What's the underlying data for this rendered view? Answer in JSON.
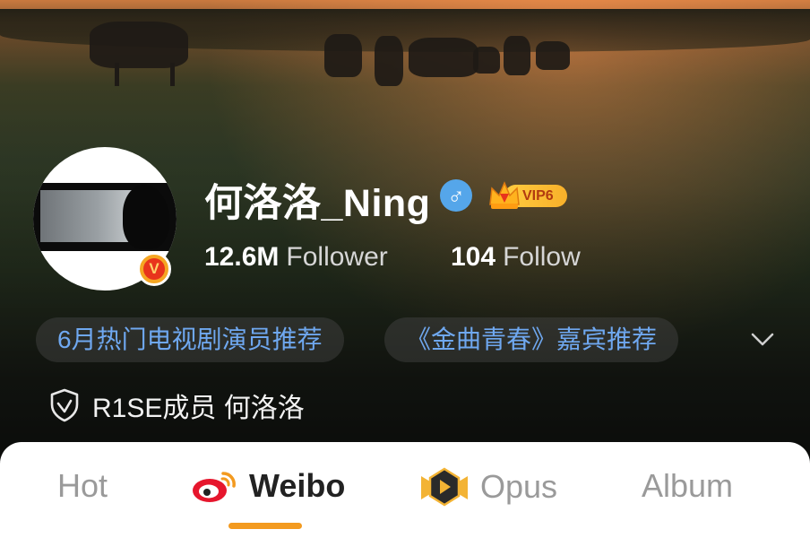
{
  "profile": {
    "name": "何洛洛_Ning",
    "gender_symbol": "♂",
    "vip_label": "VIP6",
    "verified_mark": "V",
    "followers_count": "12.6M",
    "followers_label": "Follower",
    "following_count": "104",
    "following_label": "Follow"
  },
  "tags": [
    {
      "label": "6月热门电视剧演员推荐"
    },
    {
      "label": "《金曲青春》嘉宾推荐"
    }
  ],
  "certification": "R1SE成员 何洛洛",
  "tabs": [
    {
      "label": "Hot",
      "active": false
    },
    {
      "label": "Weibo",
      "active": true
    },
    {
      "label": "Opus",
      "active": false
    },
    {
      "label": "Album",
      "active": false
    }
  ],
  "colors": {
    "accent": "#f39a1f",
    "tag_text": "#6fa8f0",
    "gender_badge": "#55a6ea",
    "vip_badge": "#f8b02a"
  },
  "icons": [
    "verified-v-icon",
    "male-gender-icon",
    "vip-crown-icon",
    "chevron-down-icon",
    "shield-check-icon",
    "weibo-logo-icon",
    "opus-play-icon"
  ]
}
